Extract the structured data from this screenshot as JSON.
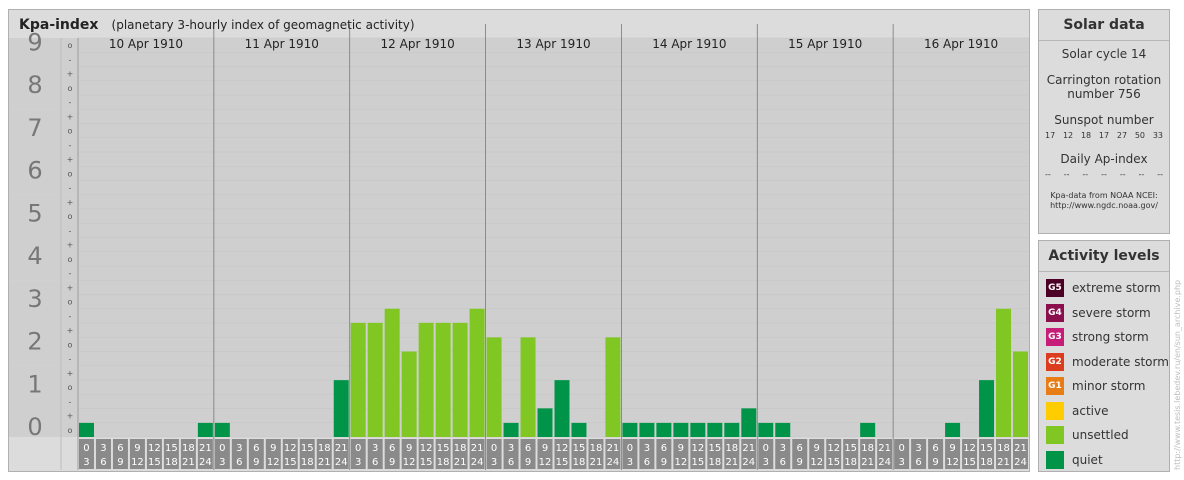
{
  "header": {
    "title": "Kpa-index",
    "subtitle": "(planetary 3-hourly index of geomagnetic activity)"
  },
  "chart_data": {
    "type": "bar",
    "y_scale_labels": [
      "0",
      "1",
      "2",
      "3",
      "4",
      "5",
      "6",
      "7",
      "8",
      "9"
    ],
    "y_sub_labels": [
      "-",
      "+",
      "o"
    ],
    "days": [
      "10 Apr 1910",
      "11 Apr 1910",
      "12 Apr 1910",
      "13 Apr 1910",
      "14 Apr 1910",
      "15 Apr 1910",
      "16 Apr 1910"
    ],
    "interval_starts": [
      "0",
      "3",
      "6",
      "9",
      "12",
      "15",
      "18",
      "21"
    ],
    "interval_ends": [
      "3",
      "6",
      "9",
      "12",
      "15",
      "18",
      "21",
      "24"
    ],
    "ylim": [
      0,
      9.33
    ],
    "values": [
      [
        0.33,
        0,
        0,
        0,
        0,
        0,
        0,
        0.33
      ],
      [
        0.33,
        0,
        0,
        0,
        0,
        0,
        0,
        1.33
      ],
      [
        2.67,
        2.67,
        3,
        2,
        2.67,
        2.67,
        2.67,
        3
      ],
      [
        2.33,
        0.33,
        2.33,
        0.67,
        1.33,
        0.33,
        0,
        2.33
      ],
      [
        0.33,
        0.33,
        0.33,
        0.33,
        0.33,
        0.33,
        0.33,
        0.67
      ],
      [
        0.33,
        0.33,
        0,
        0,
        0,
        0,
        0.33,
        0
      ],
      [
        0,
        0,
        0,
        0.33,
        0,
        1.33,
        3,
        2
      ]
    ],
    "colors": {
      "quiet": "#009449",
      "unsettled": "#80c723",
      "panel": "#dcdcdc",
      "band_dark": "#cfcfcf",
      "band_light": "#e3e3e3"
    }
  },
  "solar": {
    "title": "Solar data",
    "cycle": "Solar cycle 14",
    "carrington_line1": "Carrington rotation",
    "carrington_line2": "number 756",
    "sunspot_label": "Sunspot number",
    "sunspot_values": [
      "17",
      "12",
      "18",
      "17",
      "27",
      "50",
      "33"
    ],
    "ap_label": "Daily Ap-index",
    "ap_values": [
      "--",
      "--",
      "--",
      "--",
      "--",
      "--",
      "--"
    ],
    "credit_line1": "Kpa-data from NOAA NCEI:",
    "credit_line2": "http://www.ngdc.noaa.gov/"
  },
  "activity": {
    "title": "Activity levels",
    "items": [
      {
        "code": "G5",
        "label": "extreme storm",
        "color": "#4d0026"
      },
      {
        "code": "G4",
        "label": "severe storm",
        "color": "#8c0f4d"
      },
      {
        "code": "G3",
        "label": "strong storm",
        "color": "#c61e78"
      },
      {
        "code": "G2",
        "label": "moderate storm",
        "color": "#dd3d1f"
      },
      {
        "code": "G1",
        "label": "minor storm",
        "color": "#e77d14"
      },
      {
        "code": "",
        "label": "active",
        "color": "#ffcc00"
      },
      {
        "code": "",
        "label": "unsettled",
        "color": "#80c723"
      },
      {
        "code": "",
        "label": "quiet",
        "color": "#009449"
      }
    ]
  },
  "watermark": "http://www.tesis.lebedev.ru/en/sun_archive.php"
}
